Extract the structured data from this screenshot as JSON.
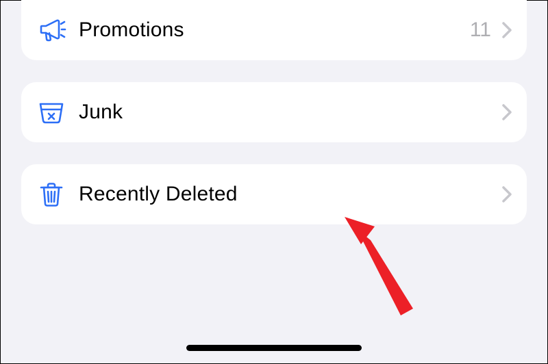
{
  "colors": {
    "accent": "#2d6ff6",
    "secondary_text": "#aeaeb2",
    "chevron": "#c7c7cc",
    "card_bg": "#ffffff",
    "page_bg": "#f2f2f7",
    "annotation": "#ec2027"
  },
  "rows": {
    "promotions": {
      "icon": "megaphone-icon",
      "label": "Promotions",
      "count": "11"
    },
    "junk": {
      "icon": "junk-basket-icon",
      "label": "Junk"
    },
    "deleted": {
      "icon": "trash-icon",
      "label": "Recently Deleted"
    }
  },
  "annotation": {
    "target": "deleted",
    "type": "arrow-up-left"
  }
}
